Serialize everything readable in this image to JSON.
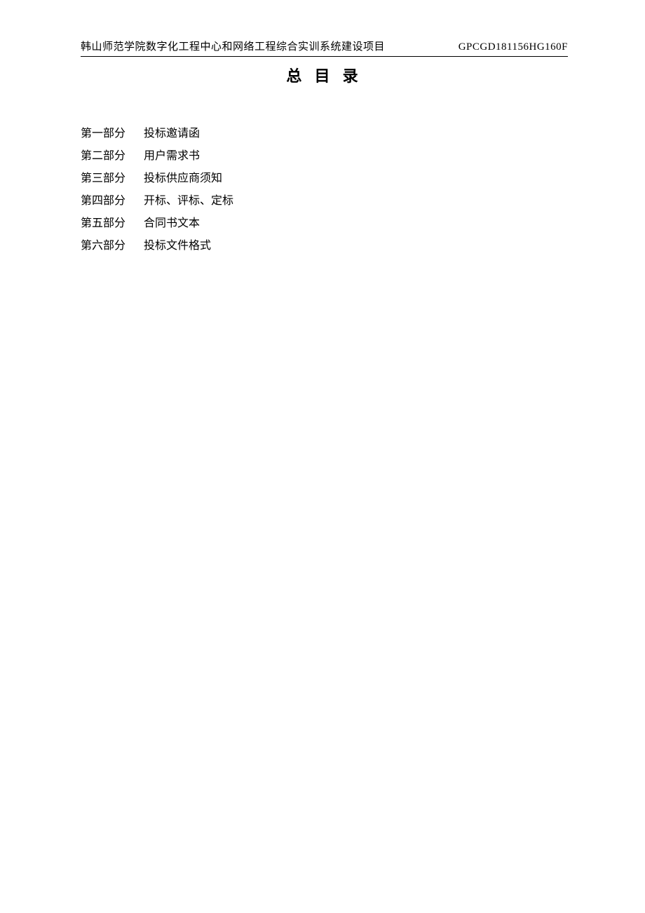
{
  "header": {
    "left": "韩山师范学院数字化工程中心和网络工程综合实训系统建设项目",
    "right": "GPCGD181156HG160F"
  },
  "title": "总 目 录",
  "toc": [
    {
      "part": "第一部分",
      "label": "投标邀请函"
    },
    {
      "part": "第二部分",
      "label": "用户需求书"
    },
    {
      "part": "第三部分",
      "label": "投标供应商须知"
    },
    {
      "part": "第四部分",
      "label": "开标、评标、定标"
    },
    {
      "part": "第五部分",
      "label": "合同书文本"
    },
    {
      "part": "第六部分",
      "label": "投标文件格式"
    }
  ]
}
